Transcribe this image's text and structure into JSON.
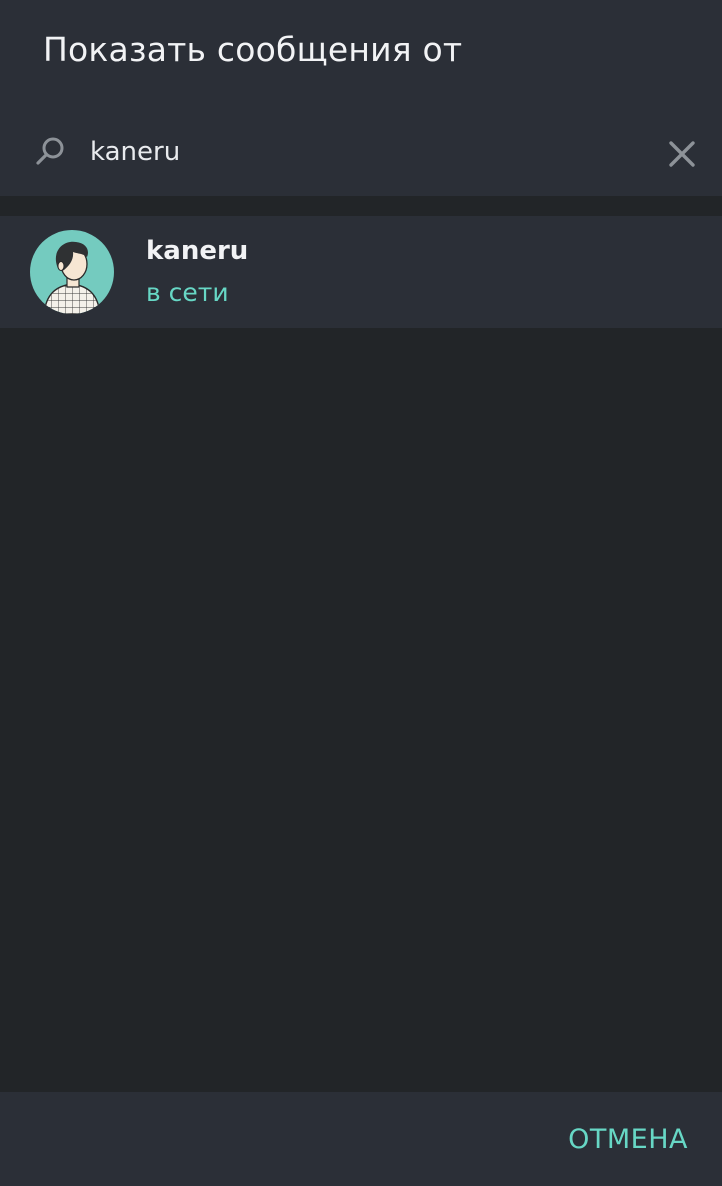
{
  "dialog": {
    "title": "Показать сообщения от"
  },
  "search": {
    "value": "kaneru",
    "search_icon": "search-icon",
    "clear_icon": "close-icon"
  },
  "results": [
    {
      "name": "kaneru",
      "status": "в сети",
      "avatar": "avatar-illustration"
    }
  ],
  "footer": {
    "cancel_label": "ОТМЕНА"
  },
  "colors": {
    "background": "#222528",
    "panel": "#2b2f37",
    "accent": "#67d7c5",
    "text": "#f2f3f5",
    "icon": "#8d9298",
    "avatar_bg": "#74cbbf"
  }
}
